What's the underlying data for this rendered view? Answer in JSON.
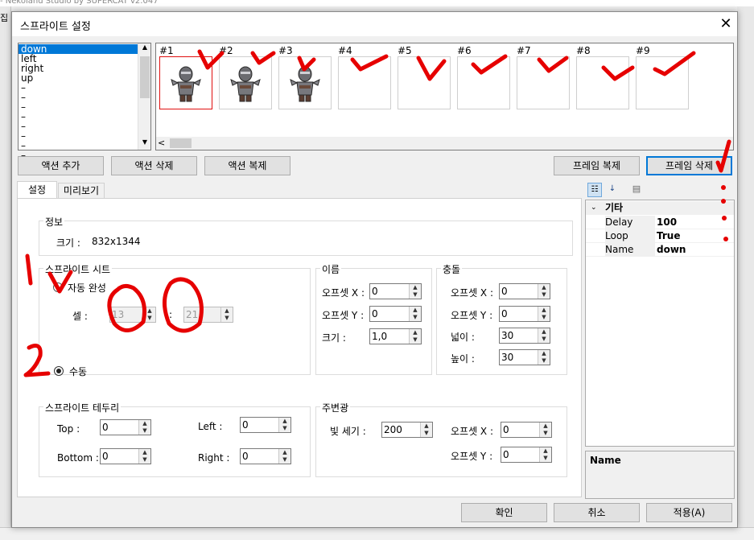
{
  "background": {
    "title": "- Nekoland Studio by SUPERCAT v2.047",
    "menu_fragment": "집"
  },
  "dialog": {
    "title": "스프라이트 설정",
    "close_glyph": "✕",
    "actions": [
      "down",
      "left",
      "right",
      "up",
      "–",
      "–",
      "–",
      "–",
      "–",
      "–",
      "–",
      "–"
    ],
    "frames": [
      {
        "label": "#1",
        "has_sprite": true
      },
      {
        "label": "#2",
        "has_sprite": true
      },
      {
        "label": "#3",
        "has_sprite": true
      },
      {
        "label": "#4",
        "has_sprite": false
      },
      {
        "label": "#5",
        "has_sprite": false
      },
      {
        "label": "#6",
        "has_sprite": false
      },
      {
        "label": "#7",
        "has_sprite": false
      },
      {
        "label": "#8",
        "has_sprite": false
      },
      {
        "label": "#9",
        "has_sprite": false
      }
    ],
    "scroll_left_glyph": "<",
    "buttons": {
      "add_action": "액션 추가",
      "delete_action": "액션 삭제",
      "copy_action": "액션 복제",
      "copy_frame": "프레임 복제",
      "delete_frame": "프레임 삭제"
    },
    "tabs": {
      "settings": "설정",
      "preview": "미리보기"
    },
    "info": {
      "title": "정보",
      "size_label": "크기 :",
      "size_value": "832x1344"
    },
    "sprite_sheet": {
      "title": "스프라이트 시트",
      "auto_label": "자동 완성",
      "cell_label": "셀 :",
      "cell_x": "13",
      "cell_sep": ":",
      "cell_y": "21",
      "manual_label": "수동"
    },
    "name_group": {
      "title": "이름",
      "offset_x_label": "오프셋 X :",
      "offset_x": "0",
      "offset_y_label": "오프셋 Y :",
      "offset_y": "0",
      "size_label": "크기 :",
      "size": "1,0"
    },
    "collision": {
      "title": "충돌",
      "offset_x_label": "오프셋 X :",
      "offset_x": "0",
      "offset_y_label": "오프셋 Y :",
      "offset_y": "0",
      "width_label": "넓이 :",
      "width": "30",
      "height_label": "높이 :",
      "height": "30"
    },
    "border": {
      "title": "스프라이트 테두리",
      "top_label": "Top :",
      "top": "0",
      "left_label": "Left :",
      "left": "0",
      "bottom_label": "Bottom :",
      "bottom": "0",
      "right_label": "Right :",
      "right": "0"
    },
    "ambient": {
      "title": "주변광",
      "intensity_label": "빛 세기 :",
      "intensity": "200",
      "offset_x_label": "오프셋 X :",
      "offset_x": "0",
      "offset_y_label": "오프셋 Y :",
      "offset_y": "0"
    },
    "properties": {
      "category": "기타",
      "rows": [
        {
          "name": "Delay",
          "value": "100"
        },
        {
          "name": "Loop",
          "value": "True"
        },
        {
          "name": "Name",
          "value": "down"
        }
      ],
      "description_title": "Name"
    },
    "footer": {
      "ok": "확인",
      "cancel": "취소",
      "apply": "적용(A)"
    }
  },
  "colors": {
    "accent": "#0078d7",
    "annotation": "#e60000",
    "selected_frame_border": "#e01010"
  }
}
